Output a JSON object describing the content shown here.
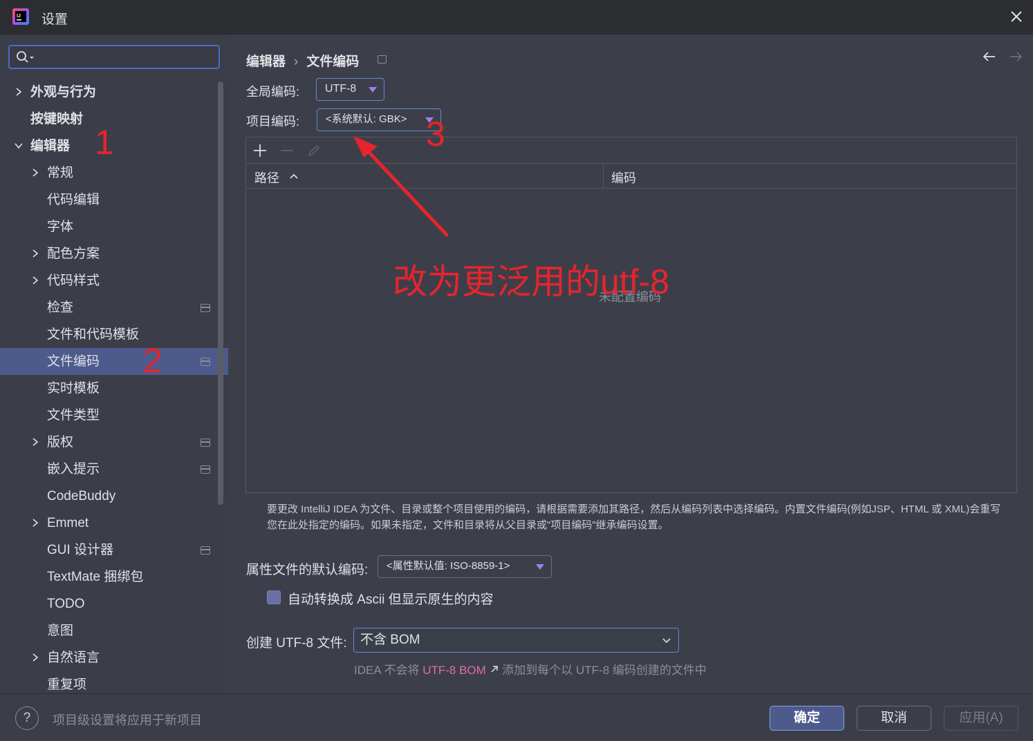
{
  "window": {
    "title": "设置"
  },
  "search": {
    "placeholder": "",
    "value": ""
  },
  "sidebar": {
    "items": [
      {
        "label": "外观与行为"
      },
      {
        "label": "按键映射"
      },
      {
        "label": "编辑器"
      },
      {
        "label": "常规"
      },
      {
        "label": "代码编辑"
      },
      {
        "label": "字体"
      },
      {
        "label": "配色方案"
      },
      {
        "label": "代码样式"
      },
      {
        "label": "检查"
      },
      {
        "label": "文件和代码模板"
      },
      {
        "label": "文件编码"
      },
      {
        "label": "实时模板"
      },
      {
        "label": "文件类型"
      },
      {
        "label": "版权"
      },
      {
        "label": "嵌入提示"
      },
      {
        "label": "CodeBuddy"
      },
      {
        "label": "Emmet"
      },
      {
        "label": "GUI 设计器"
      },
      {
        "label": "TextMate 捆绑包"
      },
      {
        "label": "TODO"
      },
      {
        "label": "意图"
      },
      {
        "label": "自然语言"
      },
      {
        "label": "重复项"
      }
    ],
    "selected": "文件编码"
  },
  "breadcrumb": {
    "parent": "编辑器",
    "current": "文件编码"
  },
  "form": {
    "global_label": "全局编码:",
    "global_value": "UTF-8",
    "project_label": "项目编码:",
    "project_value": "<系统默认: GBK>",
    "table": {
      "columns": [
        "路径",
        "编码"
      ],
      "empty_text": "未配置编码"
    },
    "info": "要更改 IntelliJ IDEA 为文件、目录或整个项目使用的编码，请根据需要添加其路径，然后从编码列表中选择编码。内置文件编码(例如JSP、HTML 或 XML)会重写您在此处指定的编码。如果未指定，文件和目录将从父目录或\"项目编码\"继承编码设置。",
    "properties_label": "属性文件的默认编码:",
    "properties_value": "<属性默认值: ISO-8859-1>",
    "ascii_checkbox_label": "自动转换成 Ascii 但显示原生的内容",
    "ascii_checked": false,
    "bom_label": "创建 UTF-8 文件:",
    "bom_value": "不含 BOM",
    "bom_hint_prefix": "IDEA 不会将",
    "bom_hint_link": "UTF-8 BOM",
    "bom_hint_suffix": "添加到每个以 UTF-8 编码创建的文件中"
  },
  "footer": {
    "help": "?",
    "note": "项目级设置将应用于新项目",
    "ok": "确定",
    "cancel": "取消",
    "apply": "应用(A)"
  },
  "annotations": {
    "one": "1",
    "two": "2",
    "three": "3",
    "message": "改为更泛用的utf-8",
    "color": "#e8242c"
  },
  "colors": {
    "accent": "#4d5a8c",
    "focus_border": "#6a84d6",
    "dropdown_arrow": "#a37cf0",
    "link": "#e06ba8"
  }
}
